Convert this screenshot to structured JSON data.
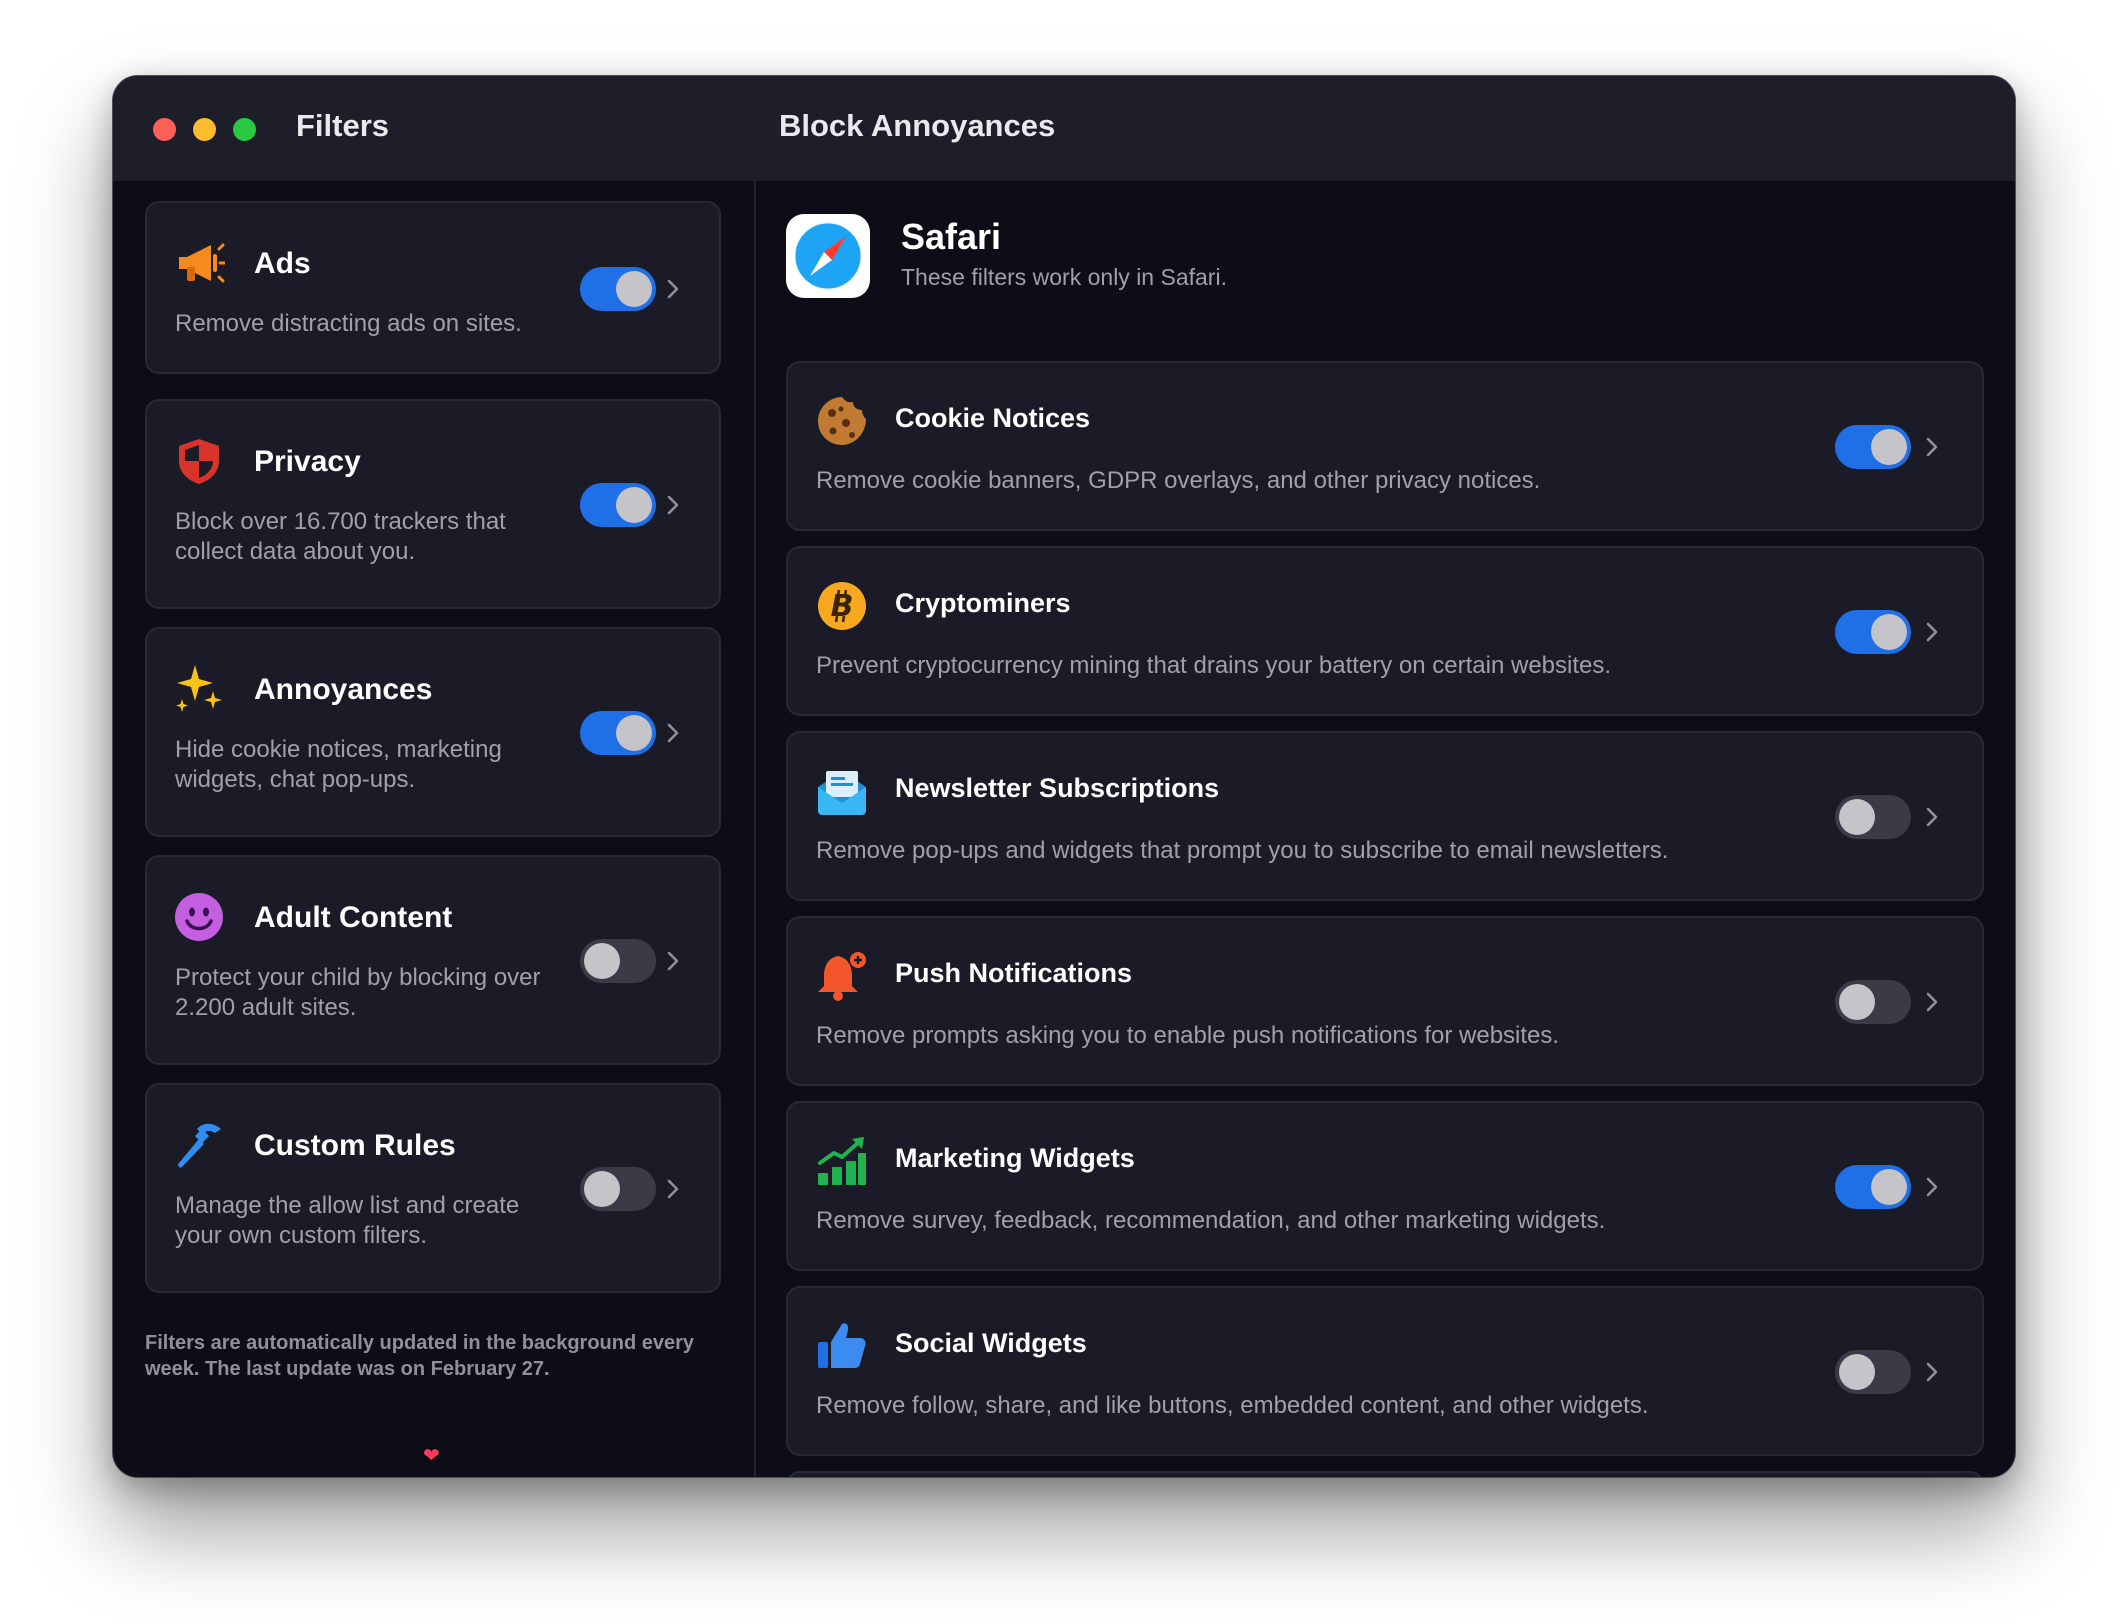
{
  "window": {
    "sidebar_title": "Filters",
    "main_title": "Block Annoyances"
  },
  "sidebar": {
    "items": [
      {
        "title": "Ads",
        "description": "Remove distracting ads on sites.",
        "enabled": true,
        "icon": "megaphone-icon"
      },
      {
        "title": "Privacy",
        "description": "Block over 16.700 trackers that collect data about you.",
        "enabled": true,
        "icon": "shield-icon"
      },
      {
        "title": "Annoyances",
        "description": "Hide cookie notices, marketing widgets, chat pop-ups.",
        "enabled": true,
        "icon": "sparkles-icon"
      },
      {
        "title": "Adult Content",
        "description": "Protect your child by blocking over 2.200 adult sites.",
        "enabled": false,
        "icon": "smiley-icon"
      },
      {
        "title": "Custom Rules",
        "description": "Manage the allow list and create your own custom filters.",
        "enabled": false,
        "icon": "hammer-icon"
      }
    ],
    "footnote": "Filters are automatically updated in the background every week. The last update was on February 27.",
    "heart": "❤"
  },
  "main": {
    "app_name": "Safari",
    "app_subtitle": "These filters work only in Safari.",
    "filters": [
      {
        "title": "Cookie Notices",
        "description": "Remove cookie banners, GDPR overlays, and other privacy notices.",
        "enabled": true,
        "icon": "cookie-icon"
      },
      {
        "title": "Cryptominers",
        "description": "Prevent cryptocurrency mining that drains your battery on certain websites.",
        "enabled": true,
        "icon": "bitcoin-icon"
      },
      {
        "title": "Newsletter Subscriptions",
        "description": "Remove pop-ups and widgets that prompt you to subscribe to email newsletters.",
        "enabled": false,
        "icon": "envelope-icon"
      },
      {
        "title": "Push Notifications",
        "description": "Remove prompts asking you to enable push notifications for websites.",
        "enabled": false,
        "icon": "bell-icon"
      },
      {
        "title": "Marketing Widgets",
        "description": "Remove survey, feedback, recommendation, and other marketing widgets.",
        "enabled": true,
        "icon": "chart-icon"
      },
      {
        "title": "Social Widgets",
        "description": "Remove follow, share, and like buttons, embedded content, and other widgets.",
        "enabled": false,
        "icon": "thumbs-up-icon"
      }
    ]
  },
  "colors": {
    "accent": "#1f6fe6",
    "window_bg": "#0c0d17",
    "card_bg": "#1a1b26",
    "titlebar_bg": "#1d1e29"
  }
}
